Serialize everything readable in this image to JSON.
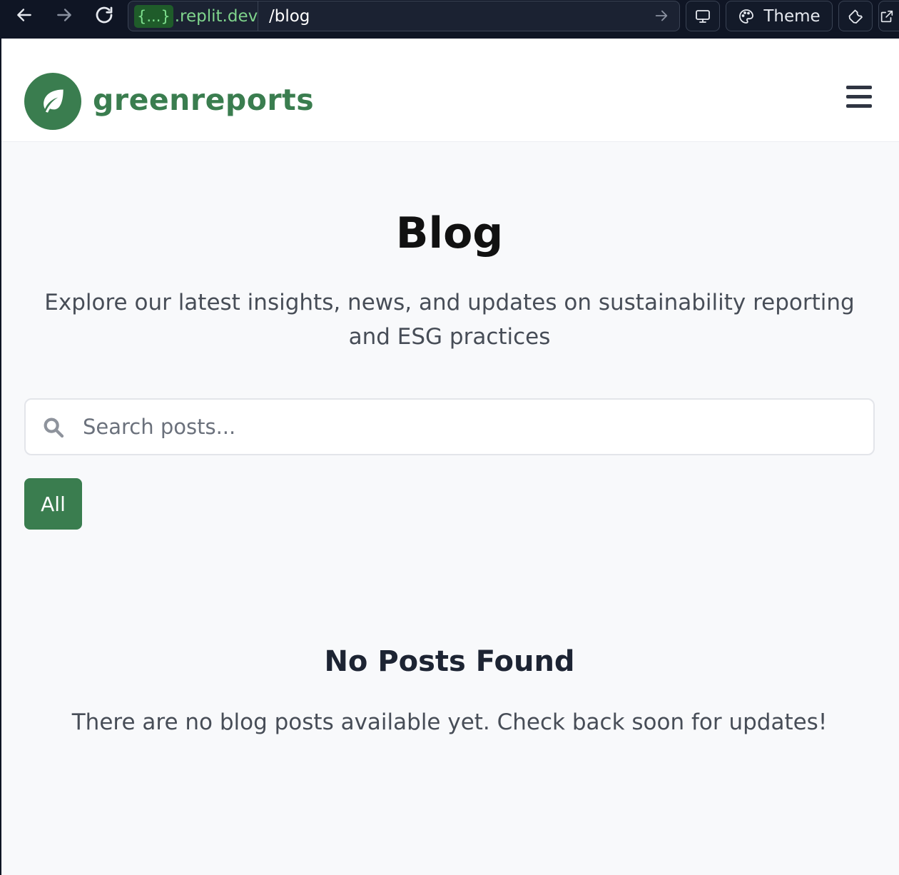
{
  "browser": {
    "url_token": "{...}",
    "url_domain": ".replit.dev",
    "url_path": "/blog",
    "theme_label": "Theme"
  },
  "header": {
    "brand": "greenreports",
    "logo_icon": "leaf-icon",
    "menu_icon": "hamburger-icon"
  },
  "main": {
    "title": "Blog",
    "subtitle": "Explore our latest insights, news, and updates on sustainability reporting and ESG practices",
    "search": {
      "placeholder": "Search posts...",
      "value": ""
    },
    "filters": [
      {
        "label": "All",
        "active": true
      }
    ],
    "empty_state": {
      "title": "No Posts Found",
      "message": "There are no blog posts available yet. Check back soon for updates!"
    }
  },
  "colors": {
    "brand_green": "#3a7d4f",
    "chrome_bg": "#0f1524",
    "page_bg": "#f8f9fb"
  }
}
